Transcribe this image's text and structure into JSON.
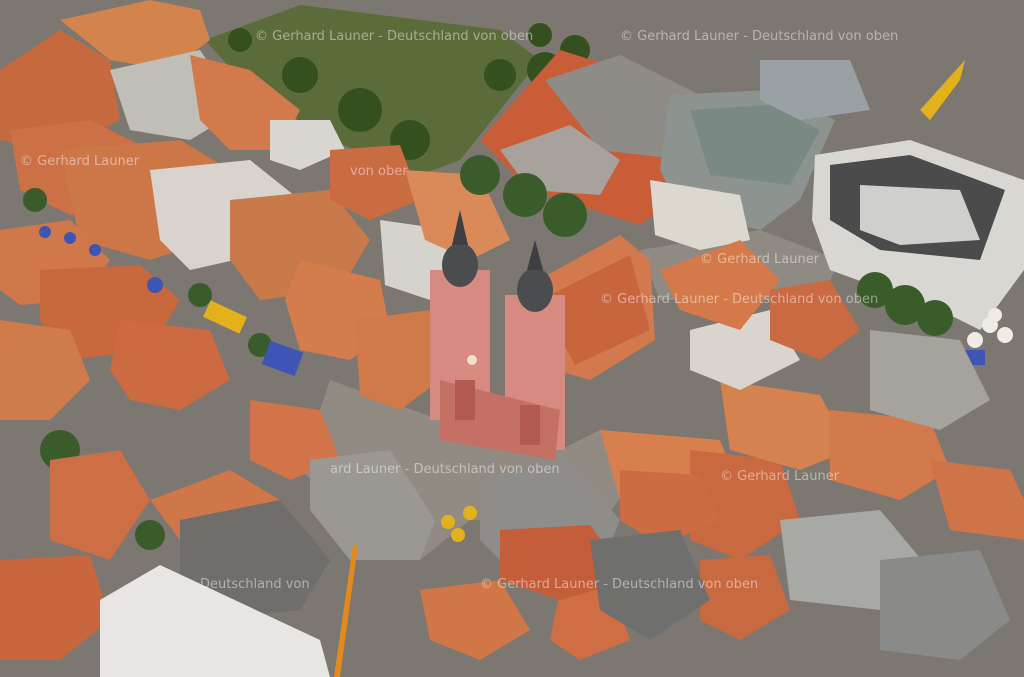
{
  "image": {
    "subject": "aerial-view-baroque-church-old-town",
    "palette": {
      "roof_red": "#c0623c",
      "roof_orange": "#d8794a",
      "church_pink": "#d78a80",
      "pavement": "#8c8781",
      "flat_roof_grey": "#8e8f8c",
      "green": "#3f5a2a",
      "umbrella_yellow": "#e3b21b",
      "umbrella_blue": "#3d55b4"
    }
  },
  "watermark": {
    "line_a": "© Gerhard Launer - Deutschland von oben",
    "line_b": "© Gerhard Launer",
    "line_c": "ard Launer - Deutschland von oben",
    "line_d": "Deutschland von",
    "line_e": "von ober"
  }
}
